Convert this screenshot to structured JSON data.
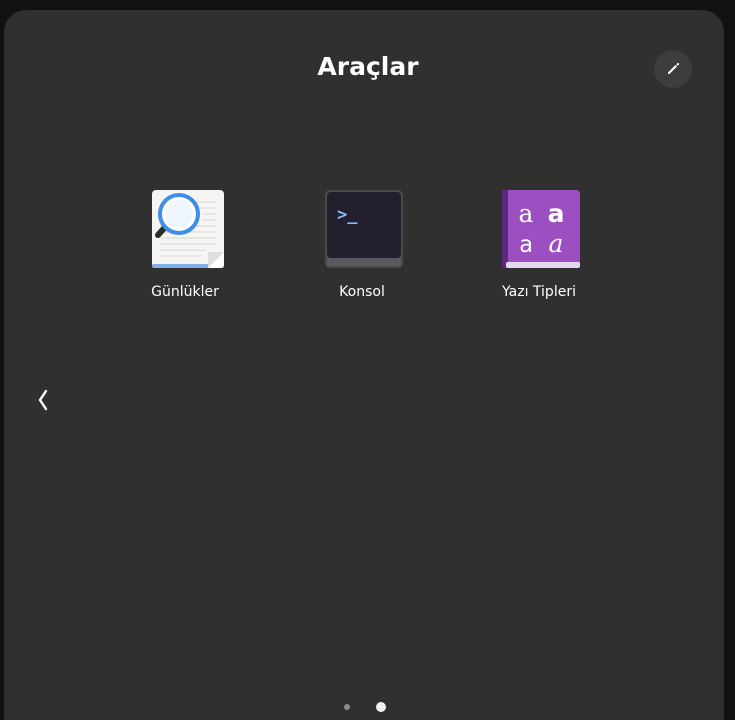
{
  "folder": {
    "title": "Araçlar"
  },
  "toolbar": {
    "edit_icon": "pencil-icon"
  },
  "apps": [
    {
      "label": "Günlükler",
      "icon": "logs-magnifier-icon"
    },
    {
      "label": "Konsol",
      "icon": "terminal-icon"
    },
    {
      "label": "Yazı Tipleri",
      "icon": "fonts-book-icon"
    }
  ],
  "terminal": {
    "prompt": ">_"
  },
  "fonts_icon": {
    "glyphs": [
      "a",
      "a",
      "a",
      "a"
    ]
  },
  "pagination": {
    "pages": 2,
    "current_page": 2
  },
  "colors": {
    "panel_background": "#303030",
    "fonts_icon_purple": "#9b4fc0",
    "terminal_background": "#231f2e",
    "magnifier_blue": "#3d8ee6"
  }
}
